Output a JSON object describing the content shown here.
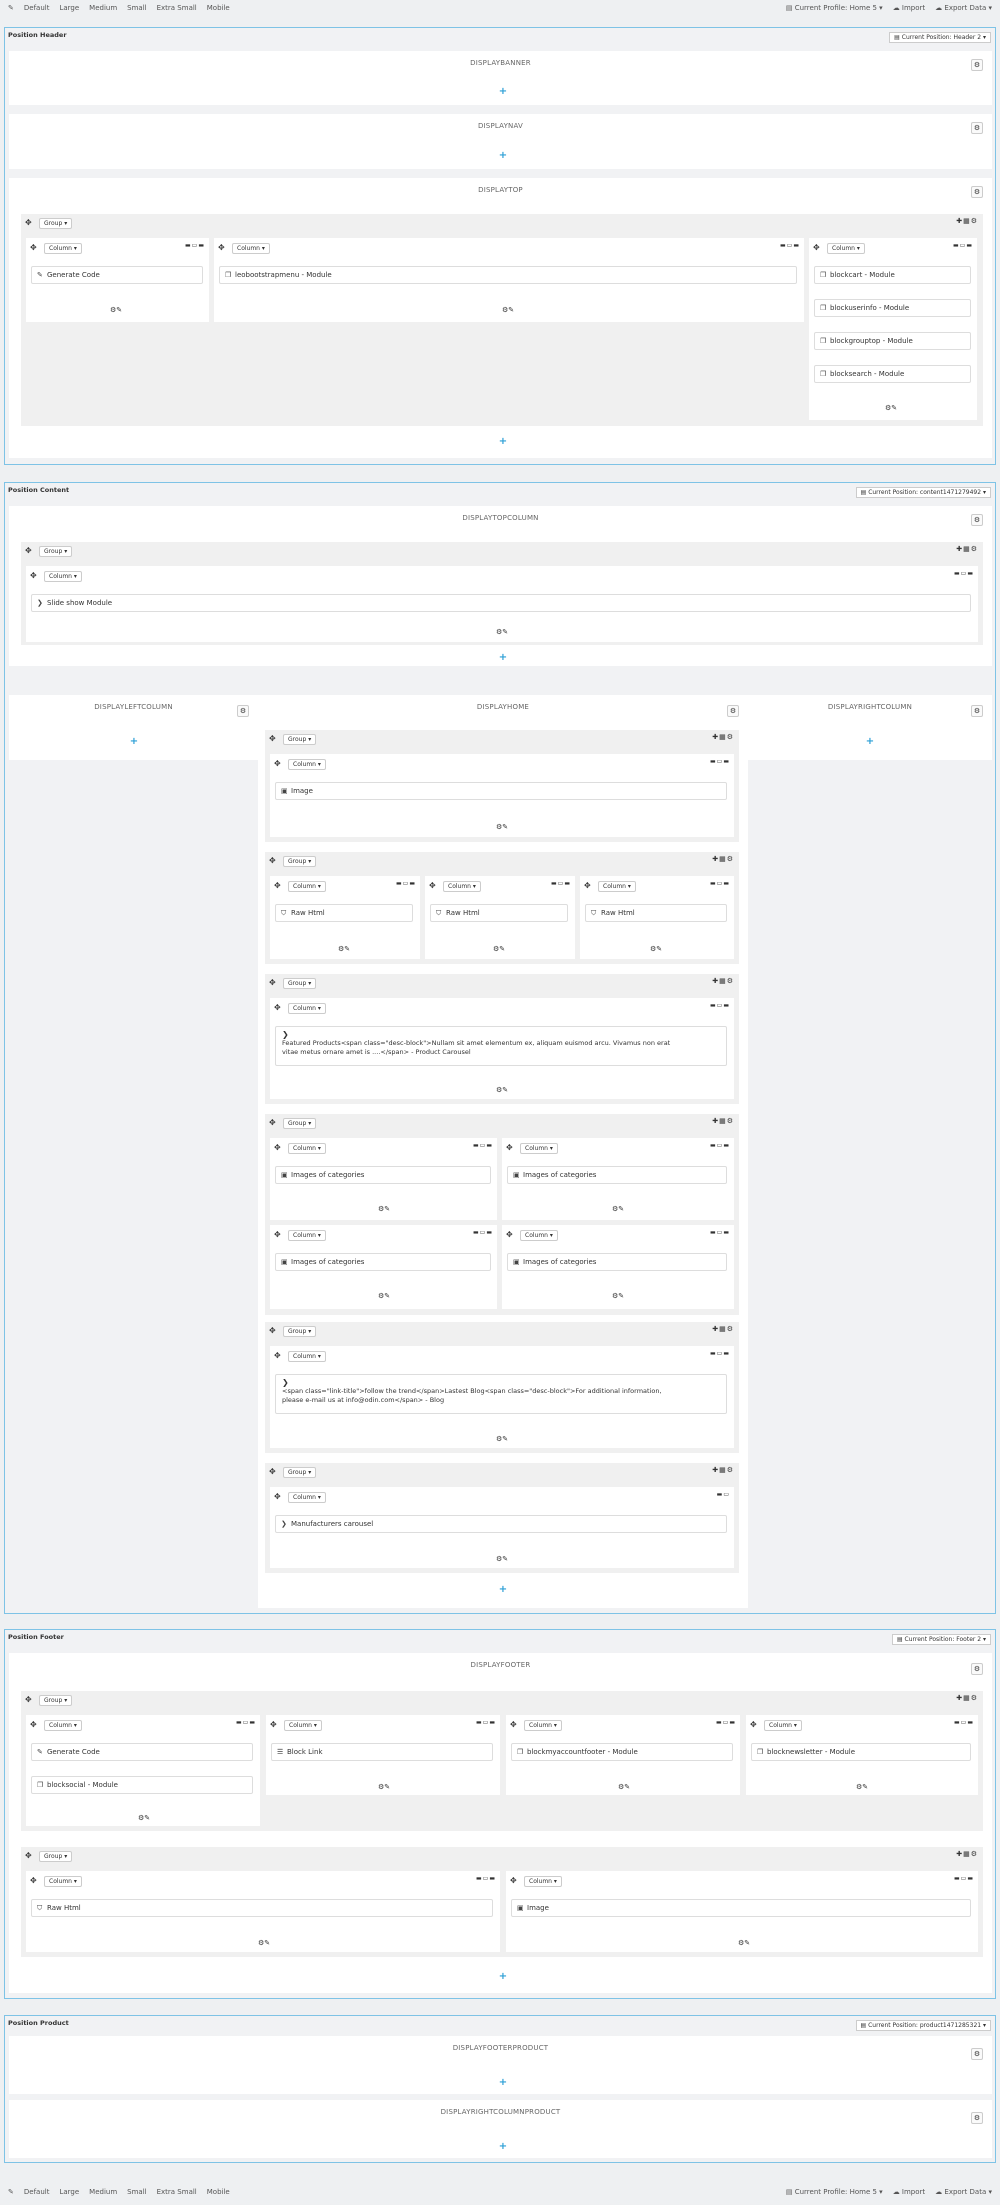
{
  "toolbar": {
    "edit_icon": "pencil-icon",
    "sizes": [
      "Default",
      "Large",
      "Medium",
      "Small",
      "Extra Small",
      "Mobile"
    ],
    "profile": "Current Profile: Home 5",
    "import": "Import",
    "export": "Export Data"
  },
  "positions": {
    "header": {
      "title": "Position Header",
      "current": "Current Position: Header 2"
    },
    "content": {
      "title": "Position Content",
      "current": "Current Position: content1471279492"
    },
    "footer": {
      "title": "Position Footer",
      "current": "Current Position: Footer 2"
    },
    "product": {
      "title": "Position Product",
      "current": "Current Position: product1471285321"
    }
  },
  "hooks": {
    "displaybanner": "DISPLAYBANNER",
    "displaynav": "DISPLAYNAV",
    "displaytop": "DISPLAYTOP",
    "displaytopcolumn": "DISPLAYTOPCOLUMN",
    "displayleftcolumn": "DISPLAYLEFTCOLUMN",
    "displayhome": "DISPLAYHOME",
    "displayrightcolumn": "DISPLAYRIGHTCOLUMN",
    "displayfooter": "DISPLAYFOOTER",
    "displayfooterproduct": "DISPLAYFOOTERPRODUCT",
    "displayrightcolumnproduct": "DISPLAYRIGHTCOLUMNPRODUCT"
  },
  "labels": {
    "group": "Group",
    "column": "Column"
  },
  "widgets": {
    "generate_code": "Generate Code",
    "leobootstrapmenu": "leobootstrapmenu - Module",
    "blockcart": "blockcart - Module",
    "blockuserinfo": "blockuserinfo - Module",
    "blockgrouptop": "blockgrouptop - Module",
    "blocksearch": "blocksearch - Module",
    "slideshow": "Slide show Module",
    "image": "Image",
    "raw_html": "Raw Html",
    "featured_1": "Featured Products<span class=\"desc-block\">Nullam sit amet elementum ex, aliquam euismod arcu. Vivamus non erat",
    "featured_2": "vitae metus ornare amet is ....</span> - Product Carousel",
    "images_categories": "Images of categories",
    "blog_1": "<span class=\"link-title\">follow the trend</span>Lastest Blog<span class=\"desc-block\">For additional information,",
    "blog_2": "please e-mail us at info@odin.com</span> - Blog",
    "manufacturers": "Manufacturers carousel",
    "blocksocial": "blocksocial - Module",
    "block_link": "Block Link",
    "blockmyaccountfooter": "blockmyaccountfooter - Module",
    "blocknewsletter": "blocknewsletter - Module"
  }
}
